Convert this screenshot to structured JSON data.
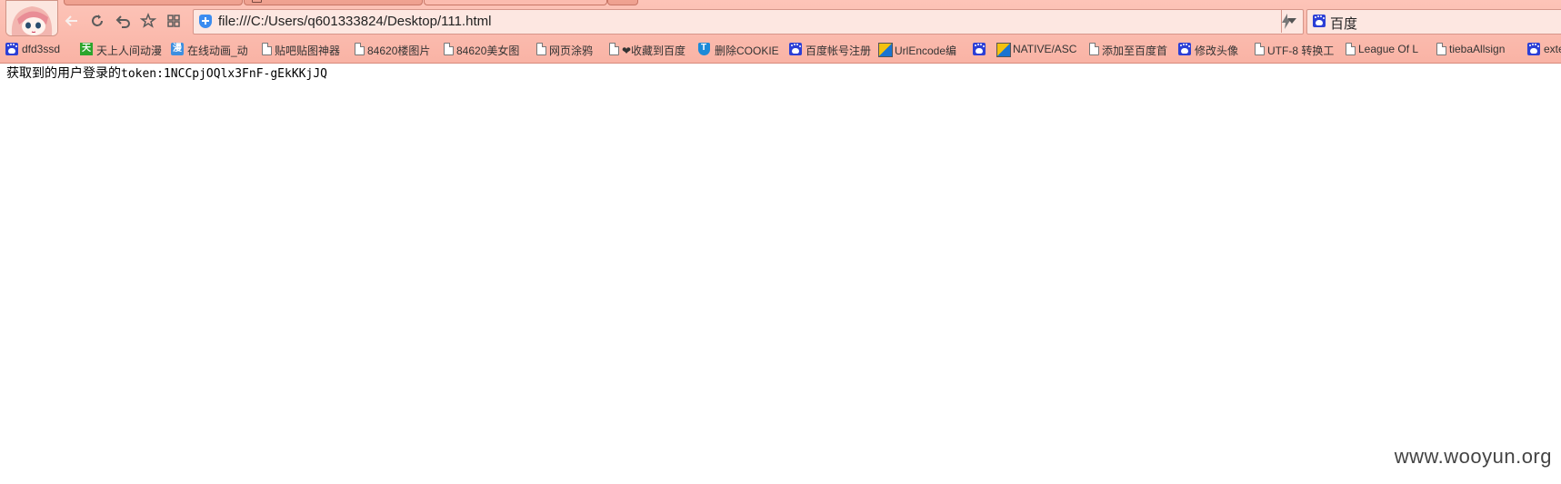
{
  "browser": {
    "address_bar": {
      "url": "file:///C:/Users/q601333824/Desktop/111.html"
    },
    "search_bar": {
      "engine_icon": "baidu-paw-icon",
      "text": "百度"
    },
    "colors": {
      "chrome": "#fbbcaf",
      "address_bg": "#fde7e1"
    }
  },
  "bookmarks": [
    {
      "label": "dfd3ssd",
      "icon": "paw"
    },
    {
      "label": "天上人间动漫",
      "icon": "green-tian"
    },
    {
      "label": "在线动画_动",
      "icon": "blue-man"
    },
    {
      "label": "贴吧贴图神器",
      "icon": "page"
    },
    {
      "label": "84620楼图片",
      "icon": "page"
    },
    {
      "label": "84620美女图",
      "icon": "page"
    },
    {
      "label": "网页涂鸦",
      "icon": "page"
    },
    {
      "label": "❤收藏到百度",
      "icon": "page"
    },
    {
      "label": "删除COOKIE",
      "icon": "shield"
    },
    {
      "label": "百度帐号注册",
      "icon": "paw"
    },
    {
      "label": "UrlEncode编",
      "icon": "split"
    },
    {
      "label": "",
      "icon": "paw"
    },
    {
      "label": "NATIVE/ASC",
      "icon": "split"
    },
    {
      "label": "添加至百度首",
      "icon": "page"
    },
    {
      "label": "修改头像",
      "icon": "paw"
    },
    {
      "label": "UTF-8 转换工",
      "icon": "page"
    },
    {
      "label": "League Of L",
      "icon": "page"
    },
    {
      "label": "tiebaAllsign",
      "icon": "page"
    },
    {
      "label": "exte",
      "icon": "paw"
    }
  ],
  "page": {
    "label": "获取到的用户登录的",
    "token": "token:1NCCpjOQlx3FnF-gEkKKjJQ"
  },
  "watermark": "www.wooyun.org"
}
